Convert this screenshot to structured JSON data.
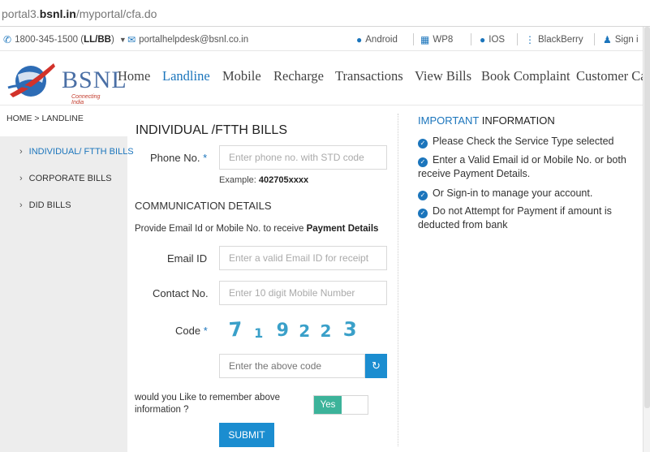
{
  "browser": {
    "url_prefix": "portal3.",
    "url_host": "bsnl.in",
    "url_path": "/myportal/cfa.do"
  },
  "topbar": {
    "phone_prefix": "1800-345-1500 (",
    "phone_bold": "LL/BB",
    "phone_suffix": ")",
    "email": "portalhelpdesk@bsnl.co.in",
    "android": "Android",
    "wp8": "WP8",
    "ios": "IOS",
    "blackberry": "BlackBerry",
    "signin": "Sign i"
  },
  "logo": {
    "name": "BSNL",
    "tagline": "Connecting India"
  },
  "nav": [
    "Home",
    "Landline",
    "Mobile",
    "Recharge",
    "Transactions",
    "View Bills",
    "Book Complaint",
    "Customer Ca"
  ],
  "breadcrumb": "HOME > LANDLINE",
  "sidebar": [
    {
      "label": "INDIVIDUAL/ FTTH BILLS"
    },
    {
      "label": "CORPORATE BILLS"
    },
    {
      "label": "DID BILLS"
    }
  ],
  "form": {
    "title": "INDIVIDUAL /FTTH BILLS",
    "phone_label": "Phone No.",
    "required_mark": "*",
    "phone_placeholder": "Enter phone no. with STD code",
    "example_label": "Example:",
    "example_value": "402705xxxx",
    "section_title": "COMMUNICATION DETAILS",
    "info_text": "Provide Email Id or Mobile No. to receive ",
    "info_bold": "Payment Details",
    "email_label": "Email ID",
    "email_placeholder": "Enter a valid Email ID for receipt",
    "contact_label": "Contact No.",
    "contact_placeholder": "Enter 10 digit Mobile Number",
    "code_label": "Code",
    "captcha": [
      "7",
      "1",
      "9",
      "2",
      "2",
      "3"
    ],
    "code_placeholder": "Enter the above code",
    "remember_text": "would you Like to remember above information ?",
    "toggle_label": "Yes",
    "toggle_state": "on",
    "submit_label": "SUBMIT"
  },
  "important": {
    "title_highlight": "IMPORTANT",
    "title_rest": " INFORMATION",
    "items": [
      "Please Check the Service Type selected",
      "Enter a Valid Email id or Mobile No. or both receive Payment Details.",
      "Or Sign-in to manage your account.",
      "Do not Attempt for Payment if amount is deducted from bank"
    ]
  },
  "colors": {
    "accent": "#1b75bc",
    "button": "#1b8dd0",
    "toggle_on": "#3cb39a",
    "captcha": "#3aa0c9"
  }
}
